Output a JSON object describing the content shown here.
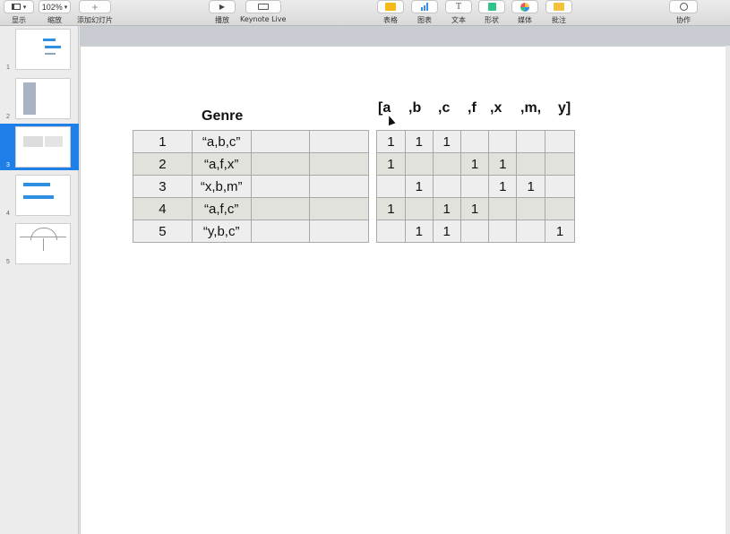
{
  "toolbar": {
    "view": {
      "label": "显示"
    },
    "zoom": {
      "value": "102%",
      "label": "缩放"
    },
    "add_slide": {
      "label": "添加幻灯片"
    },
    "play": {
      "label": "播放"
    },
    "keynote_live": {
      "label": "Keynote Live"
    },
    "table": {
      "label": "表格",
      "color": "#f5b817"
    },
    "chart": {
      "label": "图表",
      "color": "#3a8ee6"
    },
    "text": {
      "label": "文本"
    },
    "shape": {
      "label": "形状",
      "color": "#2fc28a"
    },
    "media": {
      "label": "媒体"
    },
    "comment": {
      "label": "批注",
      "color": "#f2c23a"
    },
    "collaborate": {
      "label": "协作"
    }
  },
  "sidebar": {
    "slides": [
      {
        "number": "1"
      },
      {
        "number": "2"
      },
      {
        "number": "3",
        "selected": true
      },
      {
        "number": "4"
      },
      {
        "number": "5"
      }
    ]
  },
  "slide": {
    "genre_header": "Genre",
    "feature_headers": [
      "[a",
      ",b",
      ",c",
      ",f",
      ",x",
      ",m,",
      "y]"
    ],
    "genre_table": [
      [
        "1",
        "“a,b,c”",
        "",
        ""
      ],
      [
        "2",
        "“a,f,x”",
        "",
        ""
      ],
      [
        "3",
        "“x,b,m”",
        "",
        ""
      ],
      [
        "4",
        "“a,f,c”",
        "",
        ""
      ],
      [
        "5",
        "“y,b,c”",
        "",
        ""
      ]
    ],
    "feature_table": [
      [
        "1",
        "1",
        "1",
        "",
        "",
        "",
        ""
      ],
      [
        "1",
        "",
        "",
        "1",
        "1",
        "",
        ""
      ],
      [
        "",
        "1",
        "",
        "",
        "1",
        "1",
        ""
      ],
      [
        "1",
        "",
        "1",
        "1",
        "",
        "",
        ""
      ],
      [
        "",
        "1",
        "1",
        "",
        "",
        "",
        "1"
      ]
    ]
  }
}
